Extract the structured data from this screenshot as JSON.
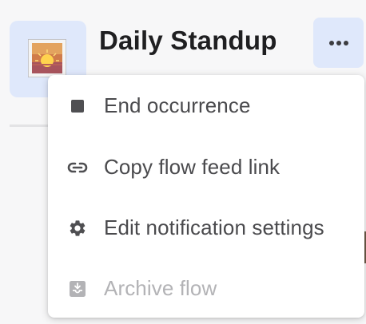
{
  "flow": {
    "title": "Daily Standup",
    "thumbnail_icon": "sunset-image-icon"
  },
  "header": {
    "more_icon": "more-horizontal-icon"
  },
  "menu": {
    "items": [
      {
        "label": "End occurrence",
        "icon": "stop-square-icon",
        "enabled": true
      },
      {
        "label": "Copy flow feed link",
        "icon": "link-icon",
        "enabled": true
      },
      {
        "label": "Edit notification settings",
        "icon": "gear-icon",
        "enabled": true
      },
      {
        "label": "Archive flow",
        "icon": "archive-tray-icon",
        "enabled": false
      }
    ]
  },
  "colors": {
    "accent_bg": "#dfe8fb",
    "menu_text": "#4a4a4d",
    "disabled_text": "#b3b3b6",
    "icon": "#4f4f52"
  }
}
